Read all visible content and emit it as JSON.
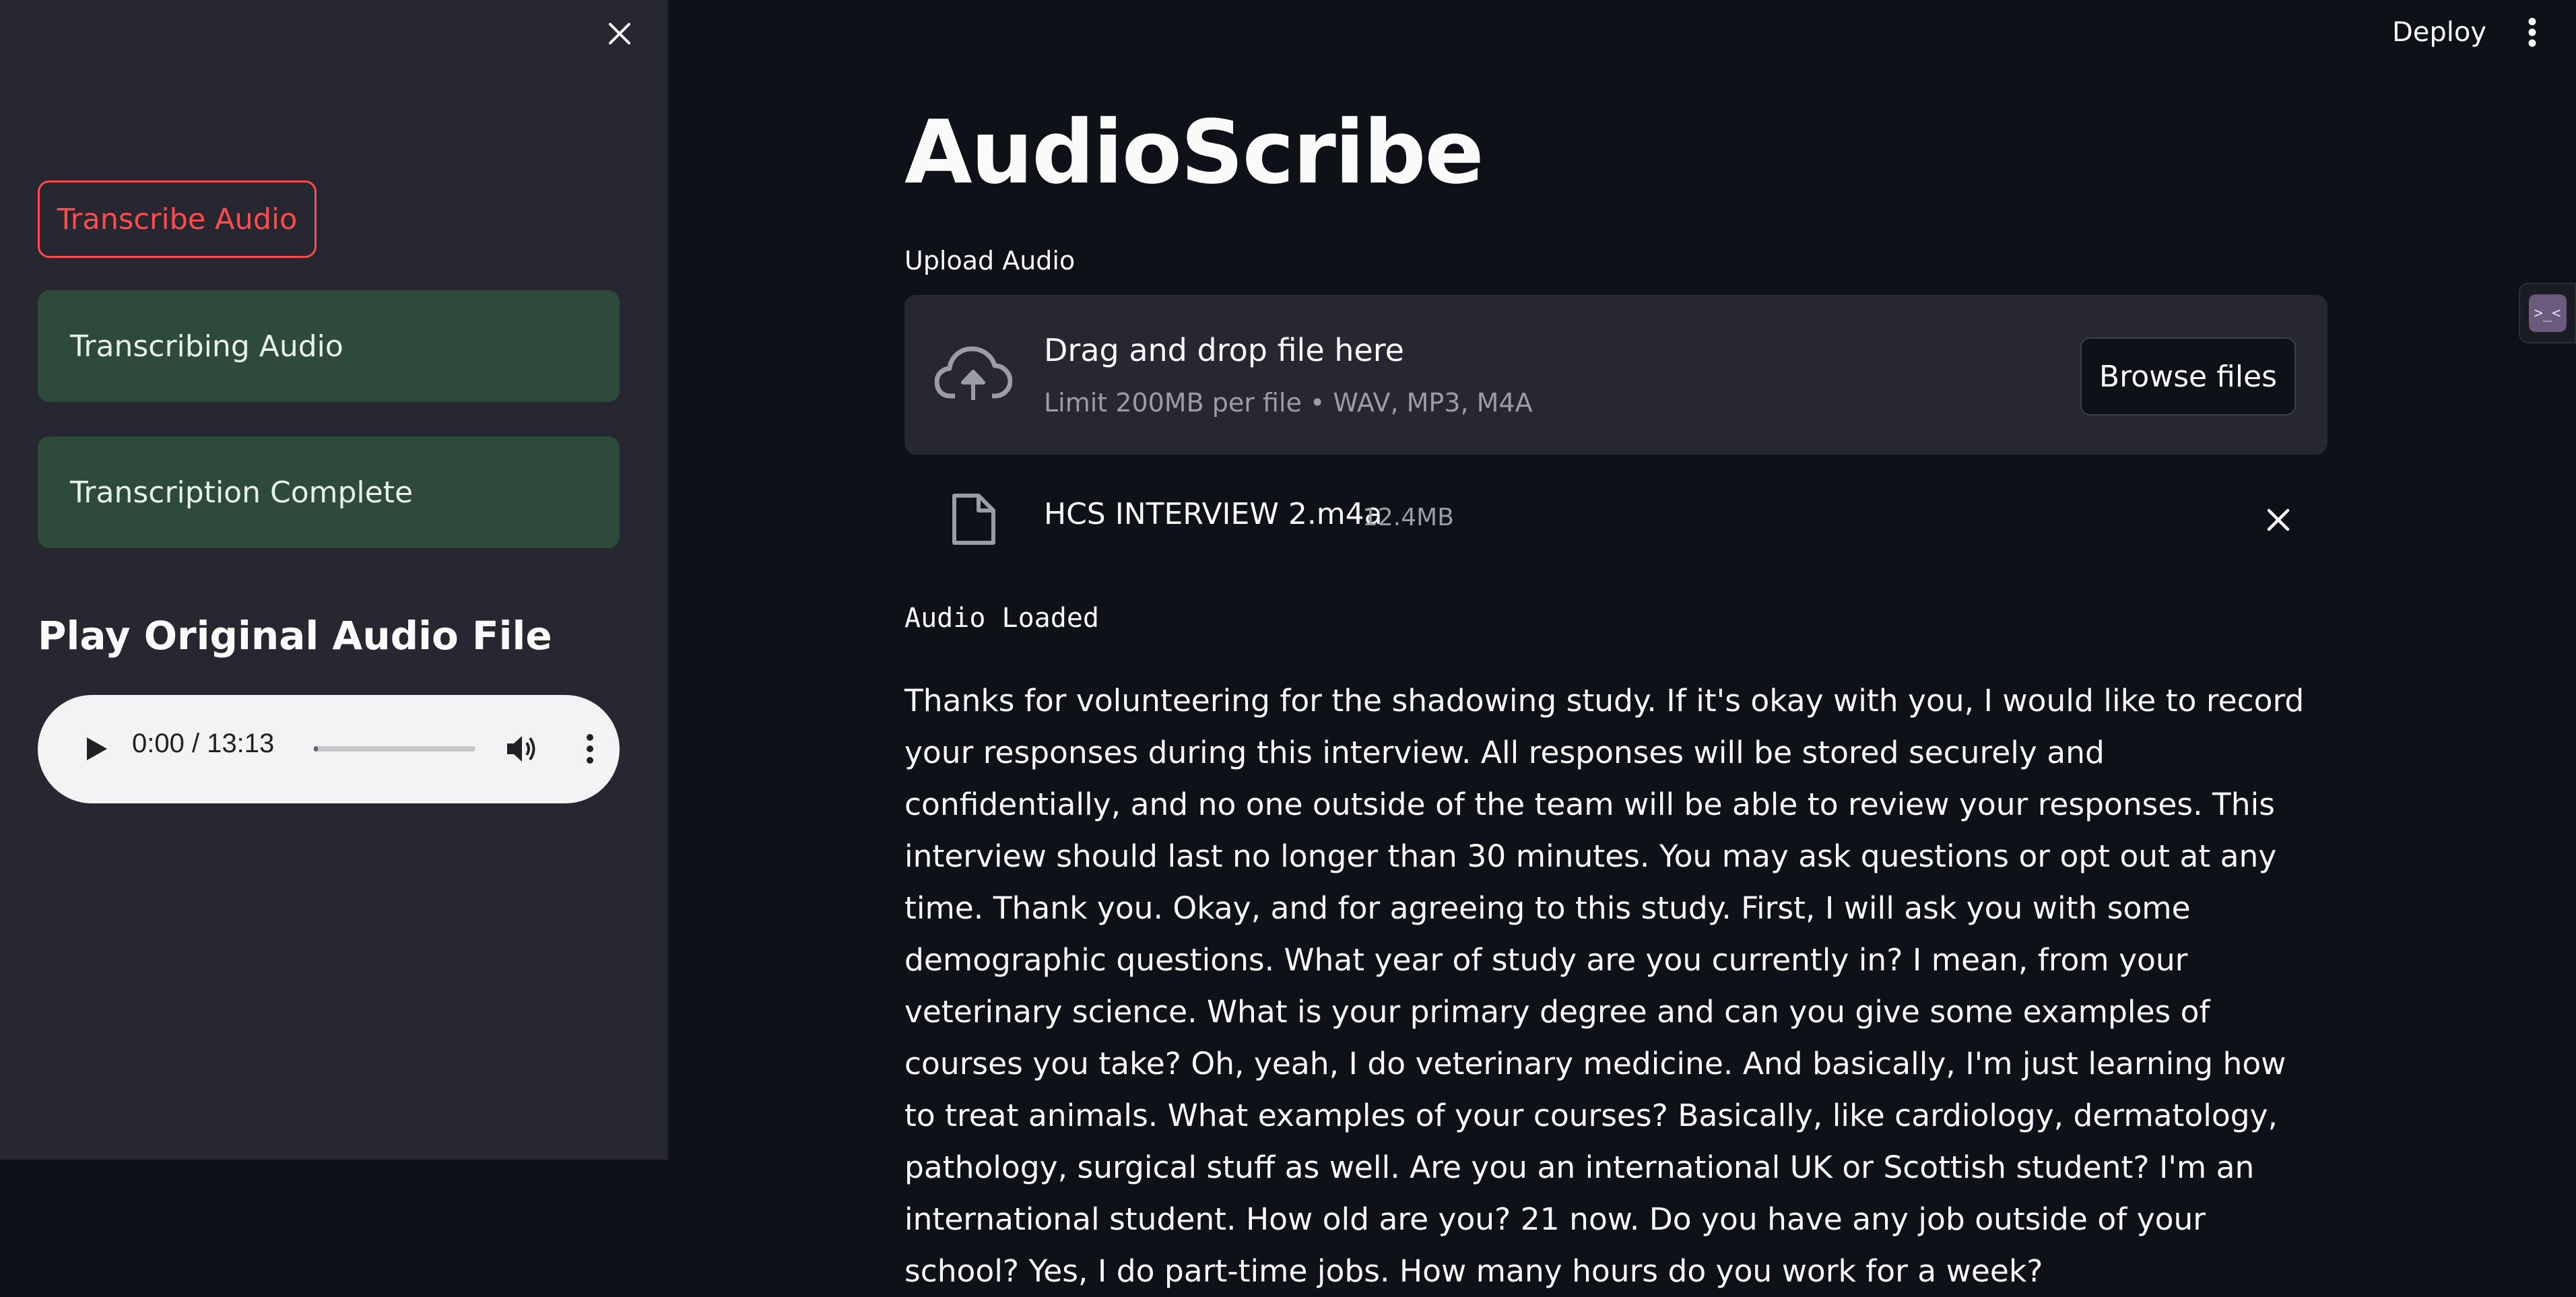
{
  "sidebar": {
    "close_icon": "close-icon",
    "transcribe_button": "Transcribe Audio",
    "status_items": [
      "Transcribing Audio",
      "Transcription Complete"
    ],
    "play_heading": "Play Original Audio File",
    "audio_player": {
      "time": "0:00 / 13:13",
      "progress": 0
    }
  },
  "header": {
    "deploy": "Deploy",
    "menu_icon": "kebab-menu-icon"
  },
  "main": {
    "title": "AudioScribe",
    "upload_label": "Upload Audio",
    "dropzone": {
      "title": "Drag and drop file here",
      "limit": "Limit 200MB per file • WAV, MP3, M4A",
      "browse": "Browse files"
    },
    "file": {
      "name": "HCS INTERVIEW 2.m4a",
      "size": "12.4MB"
    },
    "status": "Audio Loaded",
    "transcript": "Thanks for volunteering for the shadowing study. If it's okay with you, I would like to record your responses during this interview. All responses will be stored securely and confidentially, and no one outside of the team will be able to review your responses. This interview should last no longer than 30 minutes. You may ask questions or opt out at any time. Thank you. Okay, and for agreeing to this study. First, I will ask you with some demographic questions. What year of study are you currently in? I mean, from your veterinary science. What is your primary degree and can you give some examples of courses you take? Oh, yeah, I do veterinary medicine. And basically, I'm just learning how to treat animals. What examples of your courses? Basically, like cardiology, dermatology, pathology, surgical stuff as well. Are you an international UK or Scottish student? I'm an international student. How old are you? 21 now. Do you have any job outside of your school? Yes, I do part-time jobs. How many hours do you work for a week?"
  },
  "colors": {
    "background": "#0e1117",
    "sidebar": "#262730",
    "accent": "#ff4b4b",
    "status_green": "#2d4a3a"
  }
}
